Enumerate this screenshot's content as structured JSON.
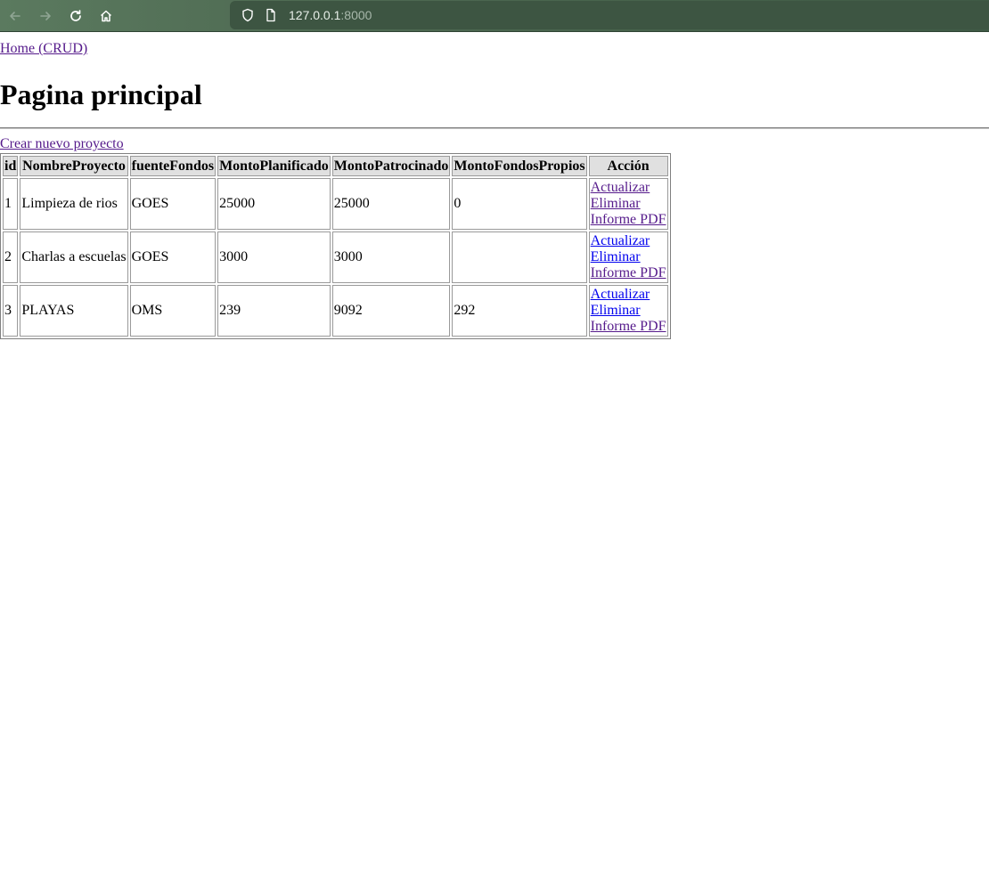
{
  "browser": {
    "url_host": "127.0.0.1",
    "url_port": ":8000"
  },
  "page": {
    "home_link": "Home (CRUD)",
    "title": "Pagina principal",
    "create_link": "Crear nuevo proyecto"
  },
  "table": {
    "headers": [
      "id",
      "NombreProyecto",
      "fuenteFondos",
      "MontoPlanificado",
      "MontoPatrocinado",
      "MontoFondosPropios",
      "Acción"
    ],
    "rows": [
      {
        "id": "1",
        "nombre": "Limpieza de rios",
        "fuente": "GOES",
        "planificado": "25000",
        "patrocinado": "25000",
        "propios": "0"
      },
      {
        "id": "2",
        "nombre": "Charlas a escuelas",
        "fuente": "GOES",
        "planificado": "3000",
        "patrocinado": "3000",
        "propios": ""
      },
      {
        "id": "3",
        "nombre": "PLAYAS",
        "fuente": "OMS",
        "planificado": "239",
        "patrocinado": "9092",
        "propios": "292"
      }
    ],
    "actions": {
      "update": "Actualizar",
      "delete": "Eliminar",
      "report": "Informe PDF"
    }
  },
  "colors": {
    "visited_link": "#551a8b",
    "link": "#0000ee",
    "header_bg": "#e0e0e0",
    "toolbar": "#4f6b53"
  }
}
